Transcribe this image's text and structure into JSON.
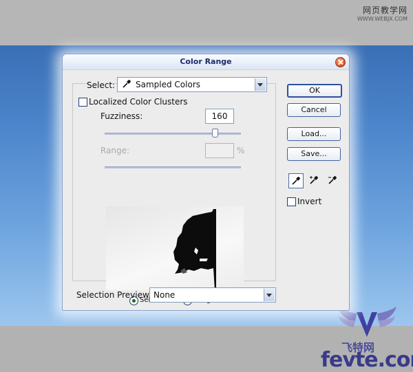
{
  "watermark_top": {
    "line1": "网页教学网",
    "line2": "WWW.WEBJX.COM"
  },
  "watermark_bottom": {
    "cn": "飞特网",
    "en": "fevte.com"
  },
  "dialog": {
    "title": "Color Range",
    "select": {
      "label": "Select:",
      "value": "Sampled Colors",
      "icon": "eyedropper-icon"
    },
    "localized": {
      "label": "Localized Color Clusters",
      "checked": false
    },
    "fuzziness": {
      "label": "Fuzziness:",
      "value": "160",
      "slider_fraction": 0.8
    },
    "range": {
      "label": "Range:",
      "value": "",
      "unit": "%"
    },
    "view_options": [
      {
        "label": "Selection",
        "selected": true
      },
      {
        "label": "Image",
        "selected": false
      }
    ],
    "buttons": {
      "ok": "OK",
      "cancel": "Cancel",
      "load": "Load...",
      "save": "Save..."
    },
    "eyedroppers": [
      "eyedropper-icon",
      "eyedropper-plus-icon",
      "eyedropper-minus-icon"
    ],
    "invert": {
      "label": "Invert",
      "checked": false
    },
    "selection_preview": {
      "label": "Selection Preview:",
      "value": "None"
    }
  }
}
